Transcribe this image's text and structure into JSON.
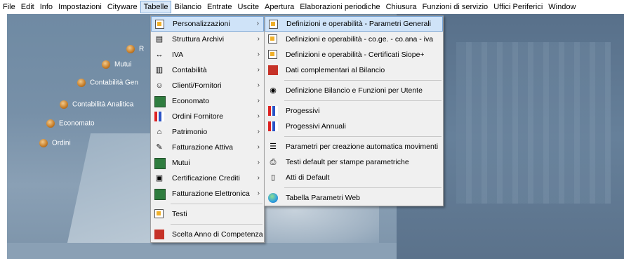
{
  "menubar": [
    "File",
    "Edit",
    "Info",
    "Impostazioni",
    "Cityware",
    "Tabelle",
    "Bilancio",
    "Entrate",
    "Uscite",
    "Apertura",
    "Elaborazioni periodiche",
    "Chiusura",
    "Funzioni di servizio",
    "Uffici Periferici",
    "Window"
  ],
  "menubar_active": "Tabelle",
  "nav": [
    {
      "label": "R"
    },
    {
      "label": "Mutui"
    },
    {
      "label": "Contabilità Gen"
    },
    {
      "label": "Contabilità Analitica"
    },
    {
      "label": "Economato"
    },
    {
      "label": "Ordini"
    }
  ],
  "menu1": [
    {
      "label": "Personalizzazioni",
      "icon": "wrench-doc-icon",
      "submenu": true,
      "highlighted": true
    },
    {
      "label": "Struttura Archivi",
      "icon": "archive-icon",
      "submenu": true
    },
    {
      "label": "IVA",
      "icon": "iva-arrows-icon",
      "submenu": true
    },
    {
      "label": "Contabilità",
      "icon": "ledger-icon",
      "submenu": true
    },
    {
      "label": "Clienti/Fornitori",
      "icon": "people-icon",
      "submenu": true
    },
    {
      "label": "Economato",
      "icon": "cash-icon",
      "submenu": true
    },
    {
      "label": "Ordini Fornitore",
      "icon": "order-chart-icon",
      "submenu": true
    },
    {
      "label": "Patrimonio",
      "icon": "building-icon",
      "submenu": true
    },
    {
      "label": "Fatturazione Attiva",
      "icon": "invoice-icon",
      "submenu": true
    },
    {
      "label": "Mutui",
      "icon": "loan-icon",
      "submenu": true
    },
    {
      "label": "Certificazione Crediti",
      "icon": "certificate-icon",
      "submenu": true
    },
    {
      "label": "Fatturazione Elettronica",
      "icon": "e-invoice-icon",
      "submenu": true
    },
    {
      "sep": true
    },
    {
      "label": "Testi",
      "icon": "text-edit-icon",
      "submenu": false
    },
    {
      "sep": true
    },
    {
      "label": "Scelta Anno di Competenza",
      "icon": "calendar-icon",
      "submenu": false
    }
  ],
  "menu2": [
    {
      "label": "Definizioni e operabilità - Parametri Generali",
      "icon": "edit-doc-icon",
      "highlighted": true
    },
    {
      "label": "Definizioni e operabilità - co.ge. - co.ana - iva",
      "icon": "edit-doc-icon"
    },
    {
      "label": "Definizioni e operabilità - Certificati Siope+",
      "icon": "edit-doc-icon"
    },
    {
      "label": "Dati complementari al Bilancio",
      "icon": "red-edit-icon"
    },
    {
      "sep": true
    },
    {
      "label": "Definizione Bilancio e Funzioni per Utente",
      "icon": "eye-icon"
    },
    {
      "sep": true
    },
    {
      "label": "Progessivi",
      "icon": "bar-chart-icon"
    },
    {
      "label": "Progessivi Annuali",
      "icon": "bar-chart-icon"
    },
    {
      "sep": true
    },
    {
      "label": "Parametri per creazione automatica movimenti",
      "icon": "list-icon"
    },
    {
      "label": "Testi default per stampe parametriche",
      "icon": "printer-icon"
    },
    {
      "label": "Atti di Default",
      "icon": "document-icon"
    },
    {
      "sep": true
    },
    {
      "label": "Tabella Parametri Web",
      "icon": "globe-icon"
    }
  ]
}
